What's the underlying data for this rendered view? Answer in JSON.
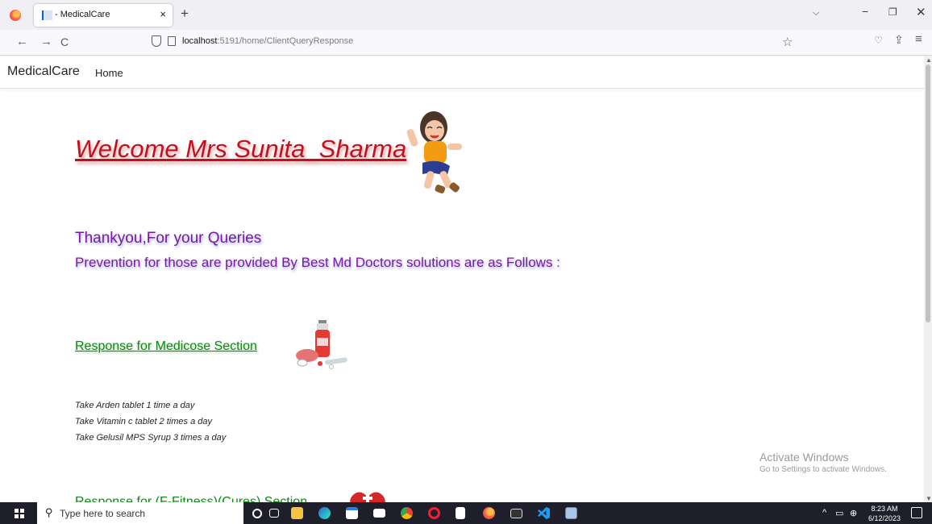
{
  "browser": {
    "tab_title": "- MedicalCare",
    "tab_close": "×",
    "new_tab": "+",
    "url_host": "localhost",
    "url_rest": ":5191/home/ClientQueryResponse",
    "tab_list": "⌵",
    "minimize": "−",
    "maximize": "❐",
    "close": "✕",
    "back": "←",
    "forward": "→",
    "reload": "C",
    "star": "☆",
    "pocket": "♡",
    "share": "⇪",
    "menu": "≡"
  },
  "site": {
    "brand": "MedicalCare",
    "home": "Home"
  },
  "content": {
    "welcome": "Welcome Mrs Sunita_Sharma",
    "thanks": "Thankyou,For your Queries",
    "prevention": "Prevention for those are provided By Best Md Doctors solutions are as Follows :",
    "response_medicose": "Response for Medicose Section",
    "prescriptions": [
      "Take Arden tablet 1 time a day",
      "Take Vitamin c tablet 2 times a day",
      "Take Gelusil MPS Syrup 3 times a day"
    ],
    "response_next": "Response for (F-Fitness)(Cures) Section"
  },
  "watermark": {
    "title": "Activate Windows",
    "subtitle": "Go to Settings to activate Windows."
  },
  "taskbar": {
    "search_placeholder": "Type here to search",
    "time": "8:23 AM",
    "date": "6/12/2023",
    "tray_up": "^",
    "icons": [
      "cortana-icon",
      "task-view-icon",
      "file-explorer-icon",
      "edge-icon",
      "store-icon",
      "mail-icon",
      "chrome-icon",
      "opera-icon",
      "notepad-icon",
      "firefox-icon",
      "terminal-icon",
      "vscode-icon",
      "image-viewer-icon"
    ]
  },
  "colors": {
    "welcome": "#c0111f",
    "heading": "#7a1aa0",
    "response": "#0c8a12"
  }
}
